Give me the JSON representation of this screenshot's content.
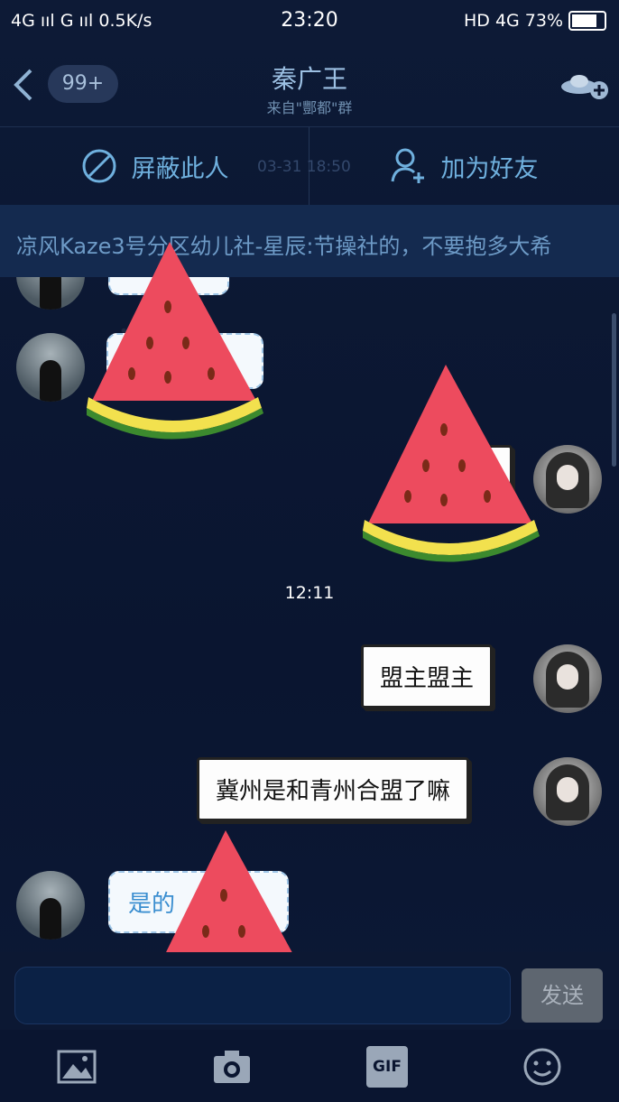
{
  "status": {
    "left": "4G ııl G ııl 0.5K/s",
    "time": "23:20",
    "network": "HD 4G",
    "battery": "73%"
  },
  "header": {
    "unread": "99+",
    "title": "秦广王",
    "subtitle": "来自\"酆都\"群"
  },
  "actions": {
    "block": "屏蔽此人",
    "add_friend": "加为好友",
    "underlying_timestamp": "03-31 18:50"
  },
  "marquee": "凉风Kaze3号分区幼儿社-星辰:节操社的，不要抱多大希",
  "messages": [
    {
      "time_sep": "12:11"
    },
    {
      "from": "me",
      "text": "盟主盟主"
    },
    {
      "from": "me",
      "text": "冀州是和青州合盟了嘛"
    },
    {
      "from": "other",
      "text": "是的"
    }
  ],
  "input": {
    "placeholder": "",
    "send_label": "发送"
  },
  "toolbar": {
    "gif_label": "GIF"
  },
  "colors": {
    "accent": "#6fb0de",
    "background": "#0c1630"
  }
}
